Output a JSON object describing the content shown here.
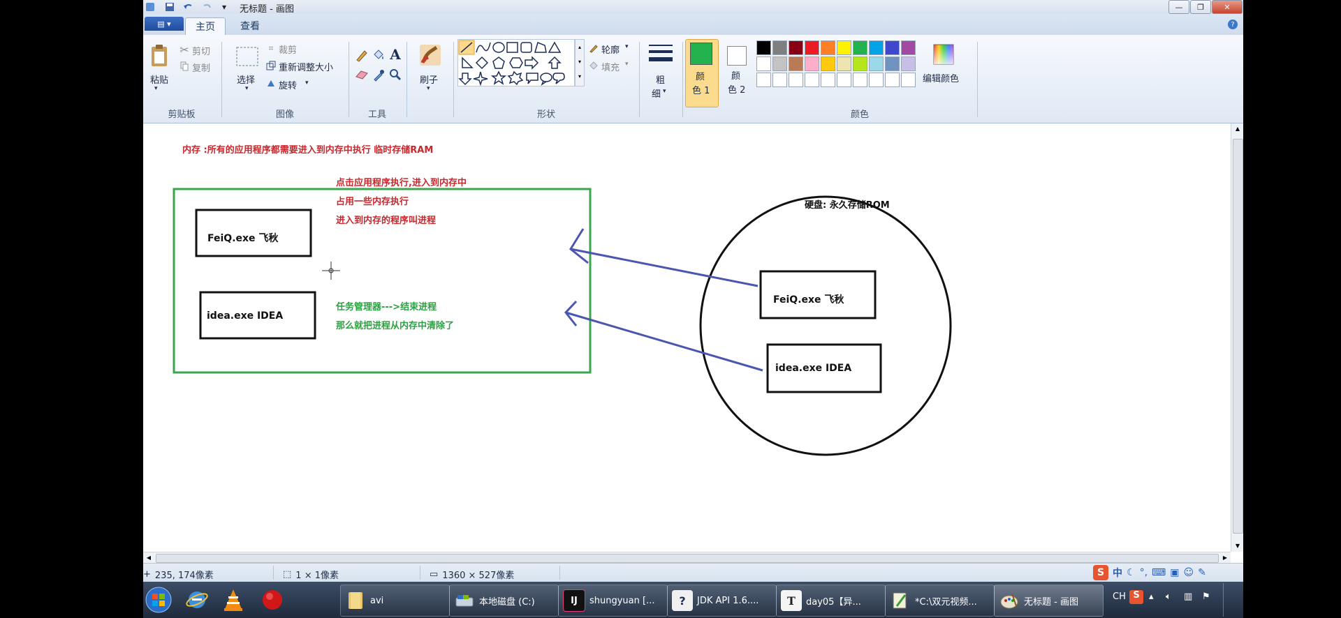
{
  "window": {
    "title": "无标题 - 画图",
    "minimize_glyph": "—",
    "restore_glyph": "❐",
    "close_glyph": "✕"
  },
  "tabs": {
    "file_glyph": "▤ ▾",
    "home": "主页",
    "view": "查看",
    "help_glyph": "?"
  },
  "ribbon": {
    "clipboard": {
      "paste": "粘贴",
      "cut": "剪切",
      "copy": "复制",
      "group": "剪贴板"
    },
    "image": {
      "select": "选择",
      "crop": "裁剪",
      "resize": "重新调整大小",
      "rotate": "旋转",
      "group": "图像"
    },
    "tools": {
      "group": "工具",
      "text_glyph": "A"
    },
    "brushes": {
      "label": "刷子"
    },
    "shapes": {
      "outline": "轮廓",
      "fill": "填充",
      "group": "形状"
    },
    "size": {
      "label_1": "粗",
      "label_2": "细"
    },
    "color1": {
      "label_1": "颜",
      "label_2": "色 1"
    },
    "color2": {
      "label_1": "颜",
      "label_2": "色 2"
    },
    "colors": {
      "group": "颜色",
      "edit": "编辑颜色"
    },
    "palette_row1": [
      "#000000",
      "#7f7f7f",
      "#880015",
      "#ed1c24",
      "#ff7f27",
      "#fff200",
      "#22b14c",
      "#00a2e8",
      "#3f48cc",
      "#a349a4"
    ],
    "palette_row2": [
      "#ffffff",
      "#c3c3c3",
      "#b97a57",
      "#ffaec9",
      "#ffc90e",
      "#efe4b0",
      "#b5e61d",
      "#99d9ea",
      "#7092be",
      "#c8bfe7"
    ],
    "color1_value": "#22b14c",
    "color2_value": "#ffffff"
  },
  "canvas": {
    "memory_title": "内存 :所有的应用程序都需要进入到内存中执行  临时存储RAM",
    "feiq_left": "FeiQ.exe 飞秋",
    "idea_left": "idea.exe IDEA",
    "red_note_1": "点击应用程序执行,进入到内存中",
    "red_note_2": "占用一些内存执行",
    "red_note_3": "进入到内存的程序叫进程",
    "green_note_1": "任务管理器--->结束进程",
    "green_note_2": "那么就把进程从内存中清除了",
    "disk_title": "硬盘: 永久存储ROM",
    "feiq_right": "FeiQ.exe 飞秋",
    "idea_right": "idea.exe IDEA",
    "colors": {
      "red": "#c8282d",
      "green": "#2ea043",
      "blue": "#4a56b0",
      "box_green": "#3aa64b"
    }
  },
  "statusbar": {
    "cursor_pos": "235, 174像素",
    "selection_size": "1 × 1像素",
    "image_size": "1360 × 527像素"
  },
  "taskbar": {
    "items": [
      {
        "label": "avi"
      },
      {
        "label": "本地磁盘 (C:)"
      },
      {
        "label": "shungyuan [..."
      },
      {
        "label": "JDK API 1.6...."
      },
      {
        "label": "day05【异..."
      },
      {
        "label": "*C:\\双元视频..."
      },
      {
        "label": "无标题 - 画图"
      }
    ],
    "ij_glyph": "IJ",
    "day_glyph": "T",
    "jdk_glyph": "?",
    "tray_ime": "CH",
    "tray_zh": "中"
  }
}
